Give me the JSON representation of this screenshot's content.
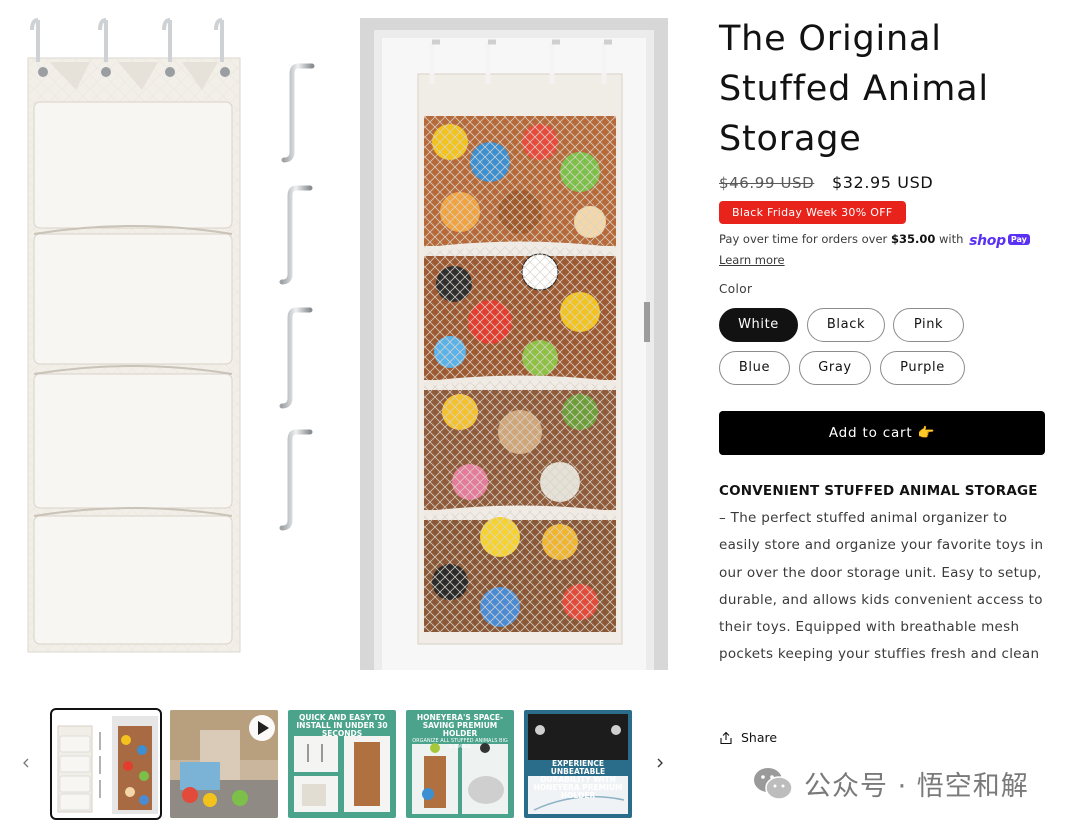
{
  "gallery": {
    "main_image_alt": "",
    "thumbnails": [
      {
        "label": "",
        "sublabel": "",
        "active": true
      },
      {
        "label": "",
        "sublabel": "",
        "has_video": true
      },
      {
        "label": "QUICK AND EASY TO INSTALL IN UNDER 30 SECONDS",
        "sublabel": ""
      },
      {
        "label": "HONEYERA'S SPACE-SAVING PREMIUM HOLDER",
        "sublabel": "ORGANIZE ALL STUFFED ANIMALS BIG & SMALL"
      },
      {
        "label": "EXPERIENCE UNBEATABLE DURABILITY WITH HONEYERA PREMIUM HOLDER",
        "sublabel": ""
      }
    ]
  },
  "product": {
    "title": "The Original Stuffed Animal Storage",
    "price_old": "$46.99 USD",
    "price_new": "$32.95 USD",
    "badge": "Black Friday Week 30% OFF",
    "installments_prefix": "Pay over time for orders over ",
    "installments_amount": "$35.00",
    "installments_suffix": " with ",
    "shop_logo": "shop",
    "shop_pay": "Pay",
    "learn_more": "Learn more",
    "color_label": "Color",
    "colors": [
      "White",
      "Black",
      "Pink",
      "Blue",
      "Gray",
      "Purple"
    ],
    "selected_color": "White",
    "add_to_cart": "Add to cart 👉",
    "description_heading": "CONVENIENT STUFFED ANIMAL STORAGE",
    "description_body": " – The perfect stuffed animal organizer to easily store and organize your favorite toys in our over the door storage unit. Easy to setup, durable, and allows kids convenient access to their toys. Equipped with breathable mesh pockets keeping your stuffies fresh and clean",
    "share_label": "Share"
  },
  "watermark": {
    "text": "公众号 · 悟空和解"
  },
  "colors": {
    "badge": "#e8231b",
    "button": "#000000",
    "shop_pay": "#5a31f4"
  },
  "icons": {
    "thumb_prev": "chevron-left-icon",
    "thumb_next": "chevron-right-icon",
    "share": "share-icon",
    "video": "play-icon",
    "watermark": "wechat-icon"
  }
}
